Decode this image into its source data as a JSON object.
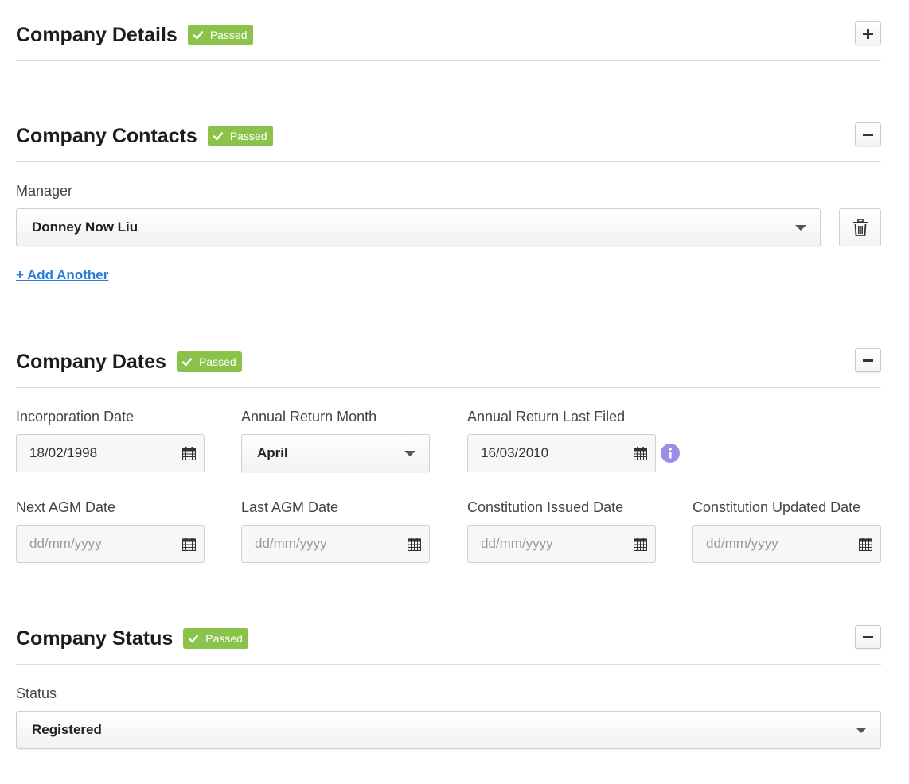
{
  "sections": {
    "details": {
      "title": "Company Details",
      "badge": "Passed",
      "toggle_icon": "plus-icon",
      "expanded": false
    },
    "contacts": {
      "title": "Company Contacts",
      "badge": "Passed",
      "toggle_icon": "minus-icon",
      "expanded": true,
      "manager_label": "Manager",
      "manager_value": "Donney Now Liu",
      "add_link": "+ Add Another"
    },
    "dates": {
      "title": "Company Dates",
      "badge": "Passed",
      "toggle_icon": "minus-icon",
      "expanded": true,
      "fields": {
        "incorporation": {
          "label": "Incorporation Date",
          "value": "18/02/1998",
          "placeholder": "dd/mm/yyyy"
        },
        "annual_return_month": {
          "label": "Annual Return Month",
          "value": "April"
        },
        "annual_return_last_filed": {
          "label": "Annual Return Last Filed",
          "value": "16/03/2010",
          "placeholder": "dd/mm/yyyy"
        },
        "next_agm": {
          "label": "Next AGM Date",
          "value": "",
          "placeholder": "dd/mm/yyyy"
        },
        "last_agm": {
          "label": "Last AGM Date",
          "value": "",
          "placeholder": "dd/mm/yyyy"
        },
        "constitution_issued": {
          "label": "Constitution Issued Date",
          "value": "",
          "placeholder": "dd/mm/yyyy"
        },
        "constitution_updated": {
          "label": "Constitution Updated Date",
          "value": "",
          "placeholder": "dd/mm/yyyy"
        }
      }
    },
    "status": {
      "title": "Company Status",
      "badge": "Passed",
      "toggle_icon": "minus-icon",
      "expanded": true,
      "status_label": "Status",
      "status_value": "Registered"
    }
  },
  "colors": {
    "badge_green": "#8bc34a",
    "link_blue": "#2b7bd8",
    "info_purple": "#9c8ce6"
  },
  "icons": {
    "check": "check-icon",
    "calendar": "calendar-icon",
    "delete": "trash-icon",
    "info": "info-icon",
    "dropdown": "chevron-down-icon"
  }
}
